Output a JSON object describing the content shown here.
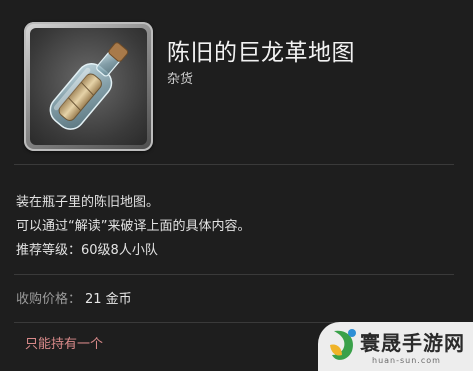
{
  "item": {
    "name": "陈旧的巨龙革地图",
    "category": "杂货",
    "icon": "message-in-bottle-icon"
  },
  "description": [
    "装在瓶子里的陈旧地图。",
    "可以通过“解读”来破译上面的具体内容。",
    "推荐等级：60级8人小队"
  ],
  "price": {
    "label": "收购价格：",
    "value": "21 金币"
  },
  "restriction": "只能持有一个",
  "watermark": {
    "text": "寰晟手游网",
    "url": "huan-sun.com"
  },
  "colors": {
    "background": "#1e1e1e",
    "restriction_text": "#d98a8a",
    "muted_label": "#9a9a9a"
  }
}
